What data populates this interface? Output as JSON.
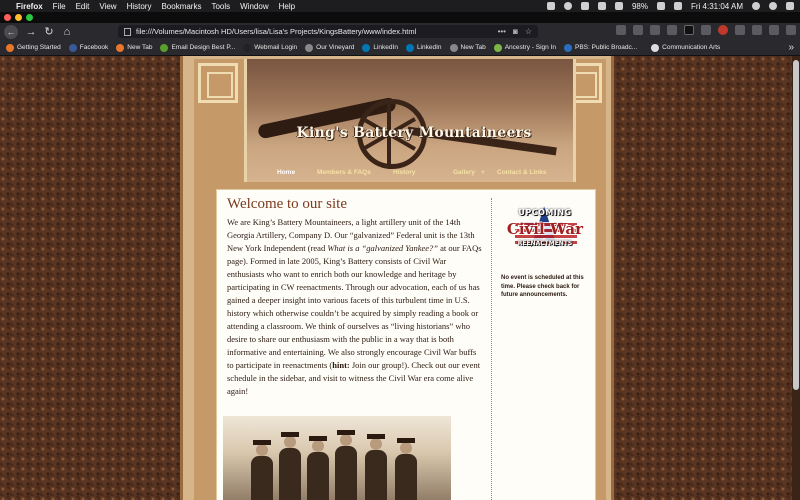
{
  "menubar": {
    "app_name": "Firefox",
    "menus": [
      "File",
      "Edit",
      "View",
      "History",
      "Bookmarks",
      "Tools",
      "Window",
      "Help"
    ],
    "battery": "98%",
    "clock": "Fri 4:31:04 AM"
  },
  "browser": {
    "url": "file:///Volumes/Macintosh HD/Users/lisa/Lisa's Projects/KingsBattery/www/index.html",
    "url_actions": "•••",
    "bookmarks": [
      {
        "label": "Getting Started",
        "color": "#e8762b"
      },
      {
        "label": "Facebook",
        "color": "#3b5998"
      },
      {
        "label": "New Tab",
        "color": "#e8762b"
      },
      {
        "label": "Email Design Best P...",
        "color": "#5aa02c"
      },
      {
        "label": "Webmail Login",
        "color": "#222222"
      },
      {
        "label": "Our Vineyard",
        "color": "#888888"
      },
      {
        "label": "LinkedIn",
        "color": "#0077b5"
      },
      {
        "label": "LinkedIn",
        "color": "#0077b5"
      },
      {
        "label": "New Tab",
        "color": "#888888"
      },
      {
        "label": "Ancestry - Sign In",
        "color": "#7ab648"
      },
      {
        "label": "PBS: Public Broadc...",
        "color": "#2a6ebb"
      },
      {
        "label": "Communication Arts",
        "color": "#dddddd"
      }
    ]
  },
  "site": {
    "title": "King's Battery Mountaineers",
    "nav": [
      {
        "label": "Home"
      },
      {
        "label": "Members & FAQs"
      },
      {
        "label": "History"
      },
      {
        "label": "Gallery"
      },
      {
        "label": "+"
      },
      {
        "label": "Contact & Links"
      }
    ],
    "heading": "Welcome to our site",
    "body_parts": {
      "p1": "We are King’s Battery Mountaineers, a light artillery unit of the 14th Georgia Artillery, Company D. Our “galvanized” Federal unit is the 13th New York Independent (read ",
      "em": "What is a “galvanized Yankee?”",
      "p2": " at our FAQs page). Formed in late 2005, King’s Battery consists of Civil War enthusiasts who want to enrich both our knowledge and heritage by participating in CW reenactments. Through our advocation, each of us has gained a deeper insight into various facets of this turbulent time in U.S. history which otherwise couldn’t be acquired by simply reading a book or attending a classroom. We think of ourselves as “living historians” who desire to share our enthusiasm with the public in a way that is both informative and entertaining. We also strongly encourage Civil War buffs to participate in reenactments (",
      "strong": "hint:",
      "p3": " Join our group!). Check out our event schedule in the sidebar, and visit to witness the Civil War era come alive again!"
    },
    "sidebar": {
      "badge_line1": "UPCOMING",
      "badge_line2": "Civil War",
      "badge_line3": "REENACTMENTS",
      "note": "No event is scheduled at this time. Please check back for future announcements."
    }
  }
}
